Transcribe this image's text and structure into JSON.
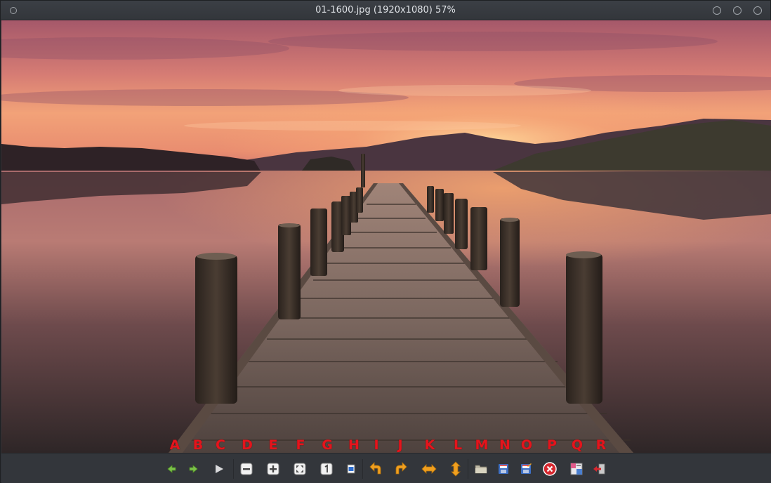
{
  "window": {
    "title": "01-1600.jpg (1920x1080) 57%"
  },
  "image": {
    "filename": "01-1600.jpg",
    "description_icon": "photo-icon"
  },
  "letters": [
    "A",
    "B",
    "C",
    "D",
    "E",
    "F",
    "G",
    "H",
    "I",
    "J",
    "K",
    "L",
    "M",
    "N",
    "O",
    "P",
    "Q",
    "R"
  ],
  "toolbar": {
    "tools": [
      {
        "id": "A",
        "icon": "arrow-left-icon",
        "label": "Previous image"
      },
      {
        "id": "B",
        "icon": "arrow-right-icon",
        "label": "Next image"
      },
      {
        "id": "C",
        "icon": "play-icon",
        "label": "Slideshow"
      },
      {
        "id": "D",
        "icon": "zoom-out-icon",
        "label": "Zoom out"
      },
      {
        "id": "E",
        "icon": "zoom-in-icon",
        "label": "Zoom in"
      },
      {
        "id": "F",
        "icon": "fit-window-icon",
        "label": "Fit to window"
      },
      {
        "id": "G",
        "icon": "original-size-icon",
        "label": "Original size"
      },
      {
        "id": "H",
        "icon": "fullscreen-icon",
        "label": "Fullscreen"
      },
      {
        "id": "I",
        "icon": "rotate-left-icon",
        "label": "Rotate left"
      },
      {
        "id": "J",
        "icon": "rotate-right-icon",
        "label": "Rotate right"
      },
      {
        "id": "K",
        "icon": "flip-horizontal-icon",
        "label": "Flip horizontally"
      },
      {
        "id": "L",
        "icon": "flip-vertical-icon",
        "label": "Flip vertically"
      },
      {
        "id": "M",
        "icon": "open-folder-icon",
        "label": "Open file"
      },
      {
        "id": "N",
        "icon": "save-icon",
        "label": "Save"
      },
      {
        "id": "O",
        "icon": "save-as-icon",
        "label": "Save as"
      },
      {
        "id": "P",
        "icon": "delete-icon",
        "label": "Delete"
      },
      {
        "id": "Q",
        "icon": "preferences-icon",
        "label": "Preferences"
      },
      {
        "id": "R",
        "icon": "exit-icon",
        "label": "Quit"
      }
    ]
  },
  "colors": {
    "letter": "#e4141c",
    "accent_orange": "#f0a020",
    "accent_green": "#7cc24a",
    "delete_red": "#d6272e"
  }
}
